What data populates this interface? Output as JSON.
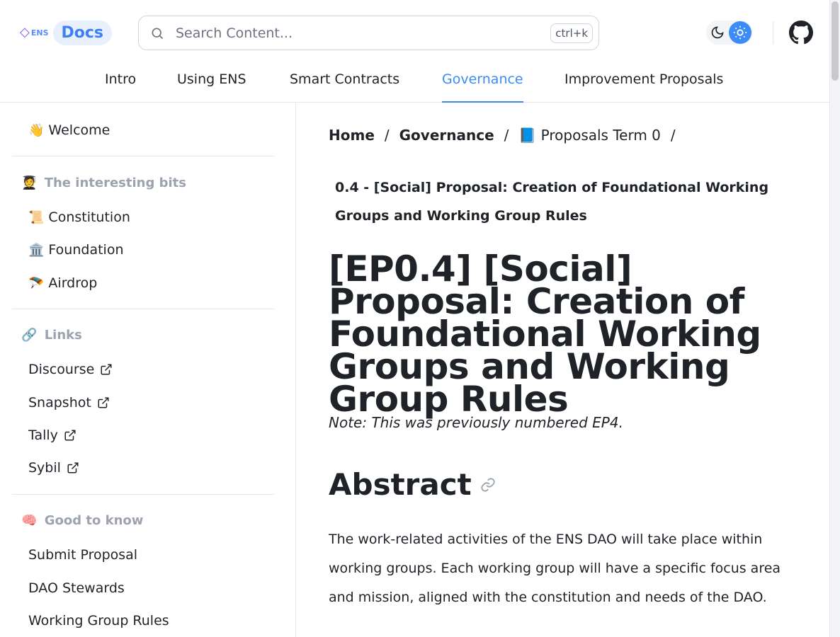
{
  "header": {
    "logo_text": "ENS",
    "docs_label": "Docs",
    "search_placeholder": "Search Content...",
    "search_shortcut": "ctrl+k"
  },
  "topnav": [
    {
      "label": "Intro"
    },
    {
      "label": "Using ENS"
    },
    {
      "label": "Smart Contracts"
    },
    {
      "label": "Governance",
      "active": true
    },
    {
      "label": "Improvement Proposals"
    }
  ],
  "sidebar": {
    "welcome": {
      "emoji": "👋",
      "label": "Welcome"
    },
    "sections": [
      {
        "emoji": "🧑‍🎓",
        "title": "The interesting bits",
        "items": [
          {
            "emoji": "📜",
            "label": "Constitution"
          },
          {
            "emoji": "🏛️",
            "label": "Foundation"
          },
          {
            "emoji": "🪂",
            "label": "Airdrop"
          }
        ]
      },
      {
        "emoji": "🔗",
        "title": "Links",
        "items": [
          {
            "label": "Discourse",
            "external": true
          },
          {
            "label": "Snapshot",
            "external": true
          },
          {
            "label": "Tally",
            "external": true
          },
          {
            "label": "Sybil",
            "external": true
          }
        ]
      },
      {
        "emoji": "🧠",
        "title": "Good to know",
        "items": [
          {
            "label": "Submit Proposal"
          },
          {
            "label": "DAO Stewards"
          },
          {
            "label": "Working Group Rules"
          }
        ]
      }
    ]
  },
  "main": {
    "breadcrumb": [
      {
        "label": "Home"
      },
      {
        "label": "Governance"
      },
      {
        "label": "📘 Proposals Term 0"
      }
    ],
    "breadcrumb_sep": "/",
    "subtitle": "0.4 - [Social] Proposal: Creation of Foundational Working Groups and Working Group Rules",
    "title": "[EP0.4] [Social] Proposal: Creation of Foundational Working Groups and Working Group Rules",
    "note": "Note: This was previously numbered EP4.",
    "abstract_heading": "Abstract",
    "abstract_text": "The work-related activities of the ENS DAO will take place within working groups. Each working group will have a specific focus area and mission, aligned with the constitution and needs of the DAO."
  },
  "colors": {
    "accent": "#3d8bf5",
    "muted": "#9ca3af",
    "text": "#1f2328"
  }
}
